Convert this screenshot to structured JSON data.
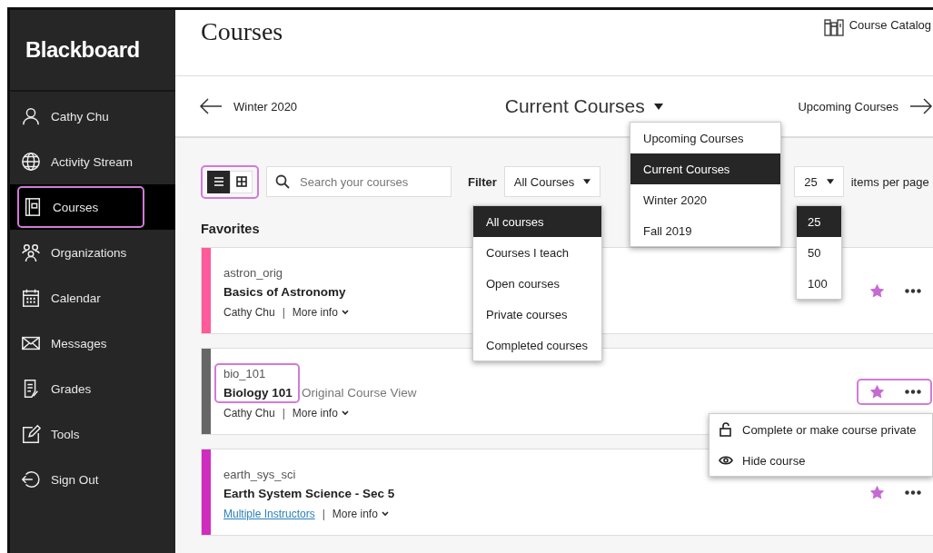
{
  "sidebar": {
    "logo": "Blackboard",
    "items": [
      {
        "label": "Cathy Chu",
        "selected": false,
        "highlighted": false
      },
      {
        "label": "Activity Stream",
        "selected": false,
        "highlighted": false
      },
      {
        "label": "Courses",
        "selected": true,
        "highlighted": true
      },
      {
        "label": "Organizations",
        "selected": false,
        "highlighted": false
      },
      {
        "label": "Calendar",
        "selected": false,
        "highlighted": false
      },
      {
        "label": "Messages",
        "selected": false,
        "highlighted": false
      },
      {
        "label": "Grades",
        "selected": false,
        "highlighted": false
      },
      {
        "label": "Tools",
        "selected": false,
        "highlighted": false
      },
      {
        "label": "Sign Out",
        "selected": false,
        "highlighted": false
      }
    ]
  },
  "header": {
    "title": "Courses",
    "catalog": "Course Catalog"
  },
  "term_nav": {
    "previous": "Winter 2020",
    "current": "Current Courses",
    "next": "Upcoming Courses"
  },
  "term_menu": [
    {
      "label": "Upcoming Courses",
      "selected": false
    },
    {
      "label": "Current Courses",
      "selected": true
    },
    {
      "label": "Winter 2020",
      "selected": false
    },
    {
      "label": "Fall 2019",
      "selected": false
    }
  ],
  "toolbar": {
    "view_toggle": {
      "highlighted": true,
      "views": [
        {
          "selected": true
        },
        {
          "selected": false
        }
      ]
    },
    "search": {
      "placeholder": "Search your courses"
    },
    "filter_label": "Filter",
    "filter_value": "All Courses",
    "per_page_value": "25",
    "per_page_label": "items per page"
  },
  "filter_menu": [
    {
      "label": "All courses",
      "selected": true
    },
    {
      "label": "Courses I teach",
      "selected": false
    },
    {
      "label": "Open courses",
      "selected": false
    },
    {
      "label": "Private courses",
      "selected": false
    },
    {
      "label": "Completed courses",
      "selected": false
    }
  ],
  "per_page_menu": [
    {
      "label": "25",
      "selected": true
    },
    {
      "label": "50",
      "selected": false
    },
    {
      "label": "100",
      "selected": false
    }
  ],
  "section_title": "Favorites",
  "courses": [
    {
      "code": "astron_orig",
      "title": "Basics of Astronomy",
      "instructor": {
        "kind": "text",
        "label": "Cathy Chu"
      },
      "separator": "|",
      "more_info": "More info",
      "color": "#ff5a9a",
      "favorite": true,
      "highlighted": false
    },
    {
      "code": "bio_101",
      "title": "Biology 101",
      "note": "Original Course View",
      "instructor": {
        "kind": "text",
        "label": "Cathy Chu"
      },
      "separator": "|",
      "more_info": "More info",
      "color": "#666666",
      "favorite": true,
      "highlighted": true
    },
    {
      "code": "earth_sys_sci",
      "title": "Earth System Science - Sec 5",
      "instructor": {
        "kind": "link",
        "label": "Multiple Instructors"
      },
      "separator": "|",
      "more_info": "More info",
      "color": "#d12cc0",
      "favorite": true,
      "highlighted": false
    }
  ],
  "course_menu": [
    {
      "label": "Complete or make course private"
    },
    {
      "label": "Hide course"
    }
  ]
}
